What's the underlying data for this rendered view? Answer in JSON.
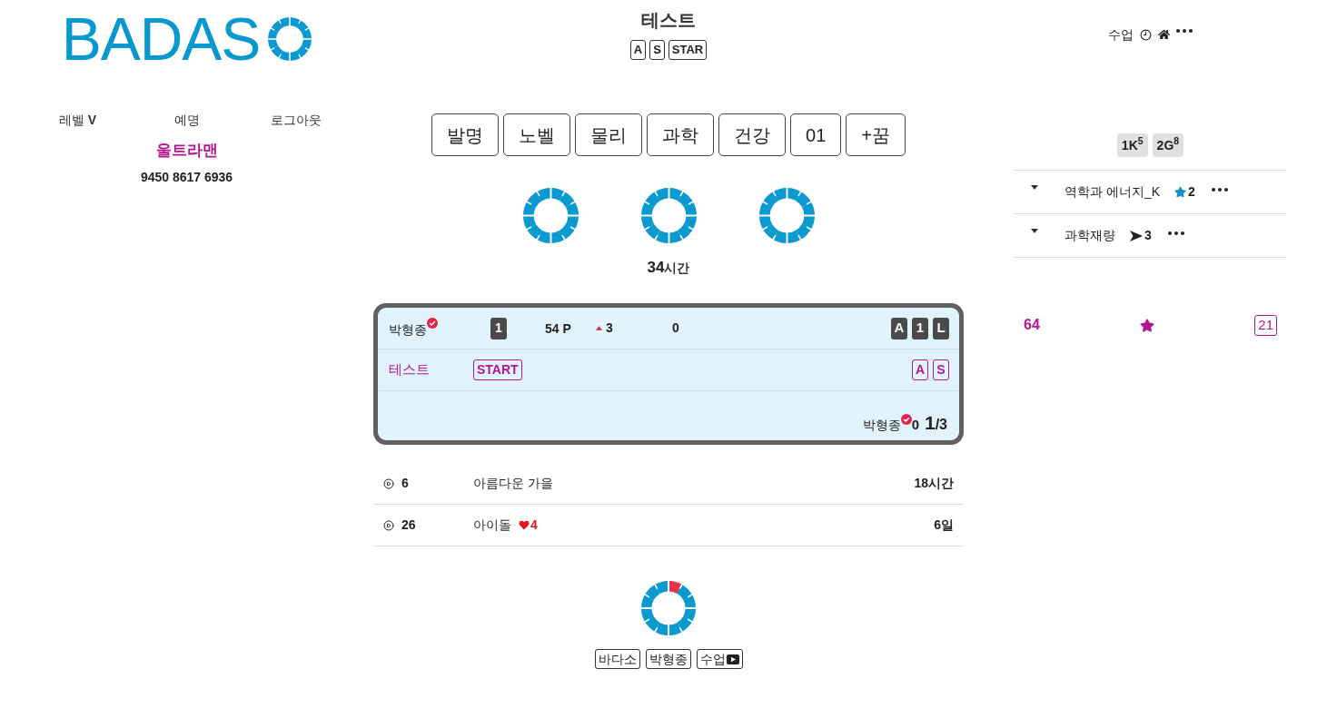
{
  "logo": {
    "text": "BADAS"
  },
  "header": {
    "title": "테스트",
    "tags": [
      "A",
      "S",
      "STAR"
    ]
  },
  "top_menu": {
    "label": "수업"
  },
  "user_nav": {
    "links": [
      "레벨 **V**",
      "예명",
      "로그아웃"
    ],
    "nickname": "울트라맨",
    "code": "9450 8617 6936"
  },
  "category_buttons": [
    "발명",
    "노벨",
    "물리",
    "과학",
    "건강",
    "01",
    "+꿈"
  ],
  "total_time": {
    "value": "34",
    "unit": "시간"
  },
  "match_card": {
    "player": {
      "name": "박형종",
      "verified": true,
      "rank": "1",
      "points": "54 P",
      "change": "3",
      "score": "0",
      "badges": [
        "A",
        "1",
        "L"
      ]
    },
    "task": {
      "title": "테스트",
      "tag": "START",
      "badges": [
        "A",
        "S"
      ]
    },
    "footer": {
      "name": "박형종",
      "verified": true,
      "score": "0",
      "current": "1",
      "total": "/3"
    }
  },
  "activities": [
    {
      "count": "6",
      "title": "아름다운 가을",
      "time": "18시간"
    },
    {
      "count": "26",
      "title": "아이돌",
      "likes": "4",
      "time": "6일"
    }
  ],
  "footer_links": [
    {
      "label": "바다소",
      "kind": "text"
    },
    {
      "label": "박형종",
      "kind": "text"
    },
    {
      "label": "수업",
      "kind": "video"
    }
  ],
  "stat_tags": [
    "1K$^{5}$",
    "2G$^{8}$"
  ],
  "courses": [
    {
      "title": "역학과 에너지_K",
      "kind": "star",
      "count": "2"
    },
    {
      "title": "과학재량",
      "kind": "arrow",
      "count": "3"
    }
  ],
  "summary": {
    "points": "64",
    "count": "21"
  }
}
